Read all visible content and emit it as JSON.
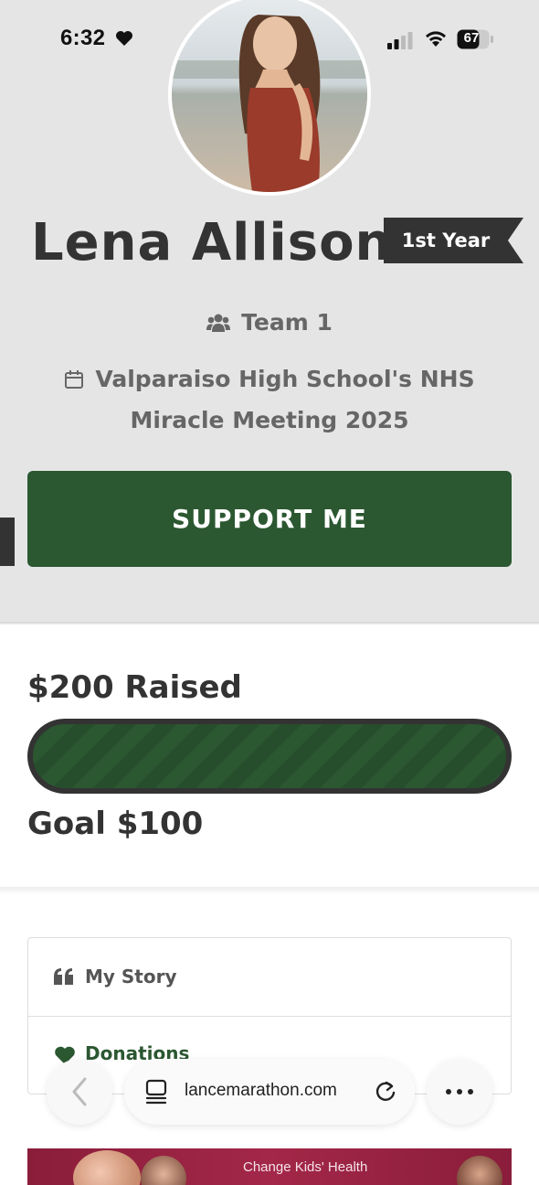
{
  "status_bar": {
    "time": "6:32",
    "battery": "67"
  },
  "profile": {
    "name": "Lena Allison",
    "badge": "1st Year",
    "team": "Team 1",
    "event": "Valparaiso High School's NHS Miracle Meeting 2025"
  },
  "actions": {
    "support_label": "SUPPORT ME"
  },
  "fundraising": {
    "raised_label": "$200 Raised",
    "goal_label": "Goal $100",
    "progress_fraction": 1.0
  },
  "tabs": [
    {
      "label": "My Story",
      "icon": "quote-icon"
    },
    {
      "label": "Donations",
      "icon": "heart-icon"
    }
  ],
  "banner": {
    "text": "Change Kids' Health"
  },
  "browser": {
    "url": "lancemarathon.com"
  },
  "colors": {
    "brand_green": "#2b5731",
    "dark": "#333333",
    "hero_bg": "#e5e5e5"
  }
}
